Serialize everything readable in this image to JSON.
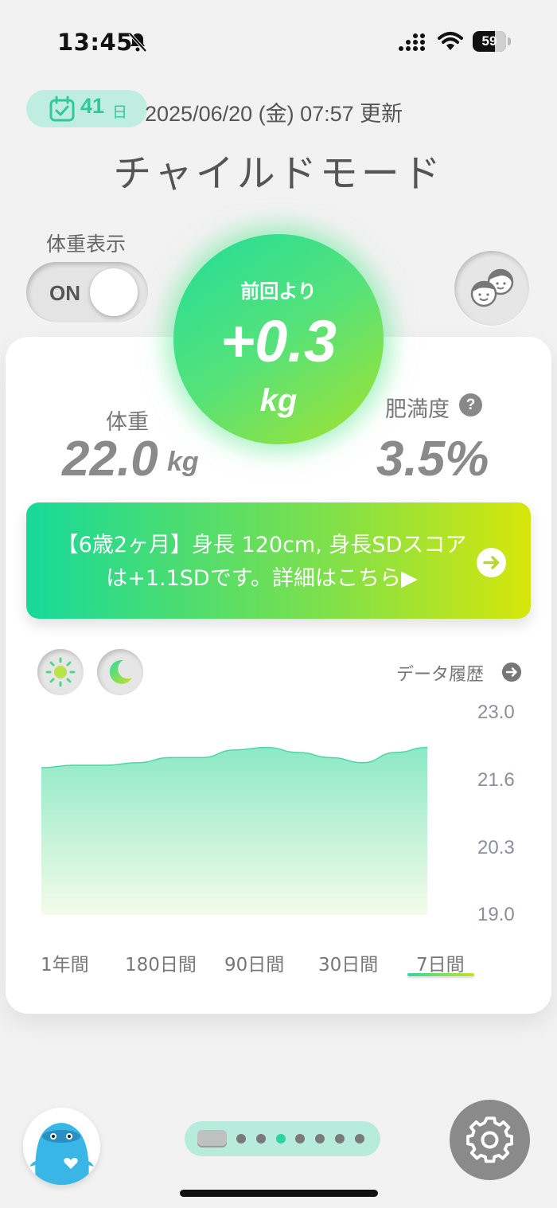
{
  "status_bar": {
    "time": "13:45",
    "battery": "59"
  },
  "header": {
    "days_count": "41",
    "days_unit": "日",
    "updated": "2025/06/20 (金) 07:57 更新",
    "title": "チャイルドモード"
  },
  "weight_display": {
    "label": "体重表示",
    "toggle_text": "ON",
    "toggle_on": true
  },
  "difference": {
    "label": "前回より",
    "value": "+0.3",
    "unit": "kg"
  },
  "stats": {
    "weight_label": "体重",
    "weight_value": "22.0",
    "weight_unit": "kg",
    "obesity_label": "肥満度",
    "obesity_help": "?",
    "obesity_value": "3.5%"
  },
  "banner": {
    "text": "【6歳2ヶ月】身長 120cm, 身長SDスコアは+1.1SDです。詳細はこちら▶"
  },
  "chart": {
    "history_label": "データ履歴",
    "y_ticks": [
      "23.0",
      "21.6",
      "20.3",
      "19.0"
    ]
  },
  "chart_data": {
    "type": "area",
    "y_ticks": [
      "23.0",
      "21.6",
      "20.3",
      "19.0"
    ],
    "ylim": [
      19.0,
      23.0
    ],
    "values": [
      21.9,
      21.95,
      21.95,
      22.0,
      22.1,
      22.1,
      22.25,
      22.3,
      22.2,
      22.1,
      22.0,
      22.2,
      22.3
    ],
    "colors": {
      "fill_top": "#8de9c6",
      "fill_bottom": "#f4fbe9",
      "stroke": "#4fd6a6"
    }
  },
  "periods": [
    "1年間",
    "180日間",
    "90日間",
    "30日間",
    "7日間"
  ],
  "selected_period": "7日間",
  "pager": {
    "pages": 8,
    "active_index": 3
  },
  "colors": {
    "accent": "#2fd3a0",
    "gradient_end": "#d7e60b",
    "badge_bg": "#bfeee0"
  }
}
